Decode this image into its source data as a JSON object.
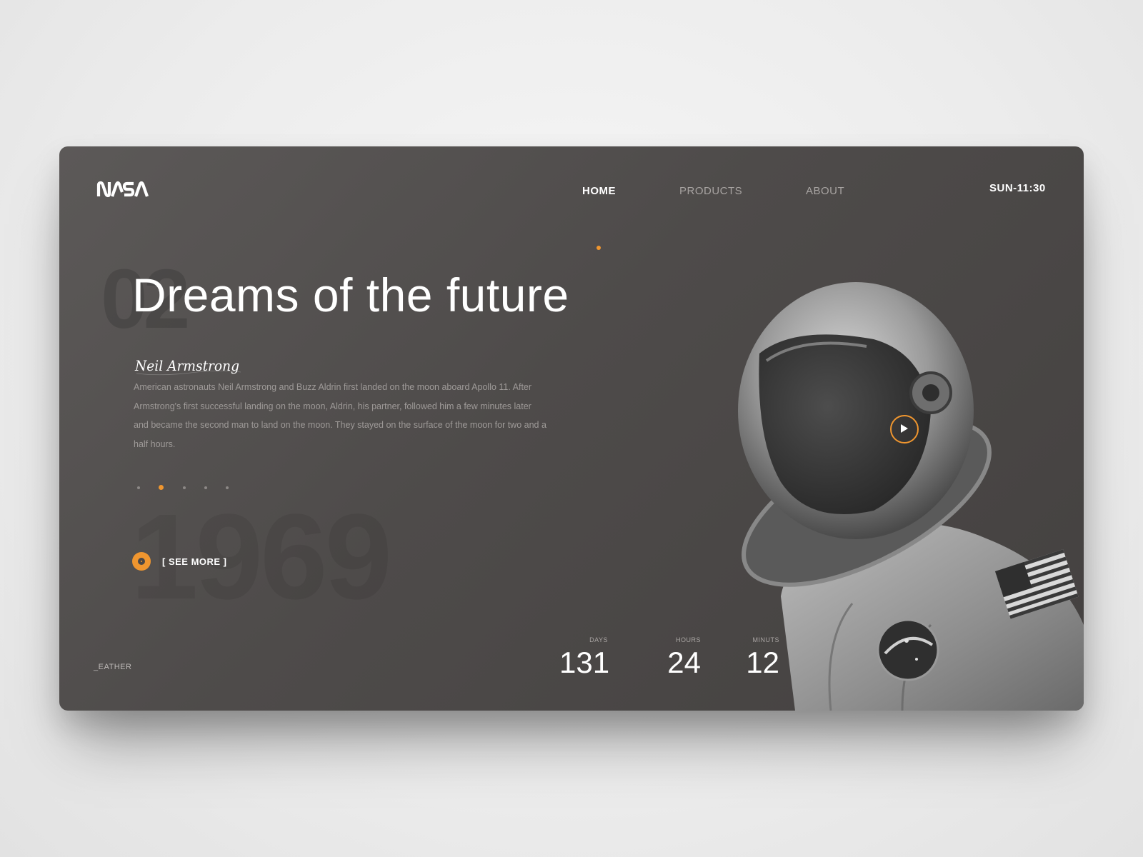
{
  "brand": {
    "logo_text": "NASA"
  },
  "nav": {
    "items": [
      {
        "label": "HOME",
        "active": true
      },
      {
        "label": "PRODUCTS",
        "active": false
      },
      {
        "label": "ABOUT",
        "active": false
      }
    ]
  },
  "clock": "SUN-11:30",
  "hero": {
    "background_number": "02",
    "background_year": "1969",
    "headline": "Dreams of the future",
    "signature": "Neil Armstrong",
    "description": "American astronauts Neil Armstrong and Buzz Aldrin first landed on the moon aboard Apollo 11. After Armstrong's first successful landing on the moon, Aldrin, his partner, followed him a few minutes later and became the second man to land on the moon. They stayed on the surface of the moon for two and a half hours.",
    "slides": {
      "count": 5,
      "active_index": 1
    },
    "see_more_label": "[ SEE MORE ]"
  },
  "footer": {
    "weather_label": "_EATHER"
  },
  "countdown": [
    {
      "label": "DAYS",
      "value": "131"
    },
    {
      "label": "HOURS",
      "value": "24"
    },
    {
      "label": "MINUTS",
      "value": "12"
    }
  ],
  "colors": {
    "accent": "#f0962f",
    "card_bg": "#4e4b4a",
    "text": "#ffffff",
    "muted": "#9e9a98"
  },
  "icons": {
    "play": "play-icon",
    "see_more": "target-dot-icon"
  }
}
